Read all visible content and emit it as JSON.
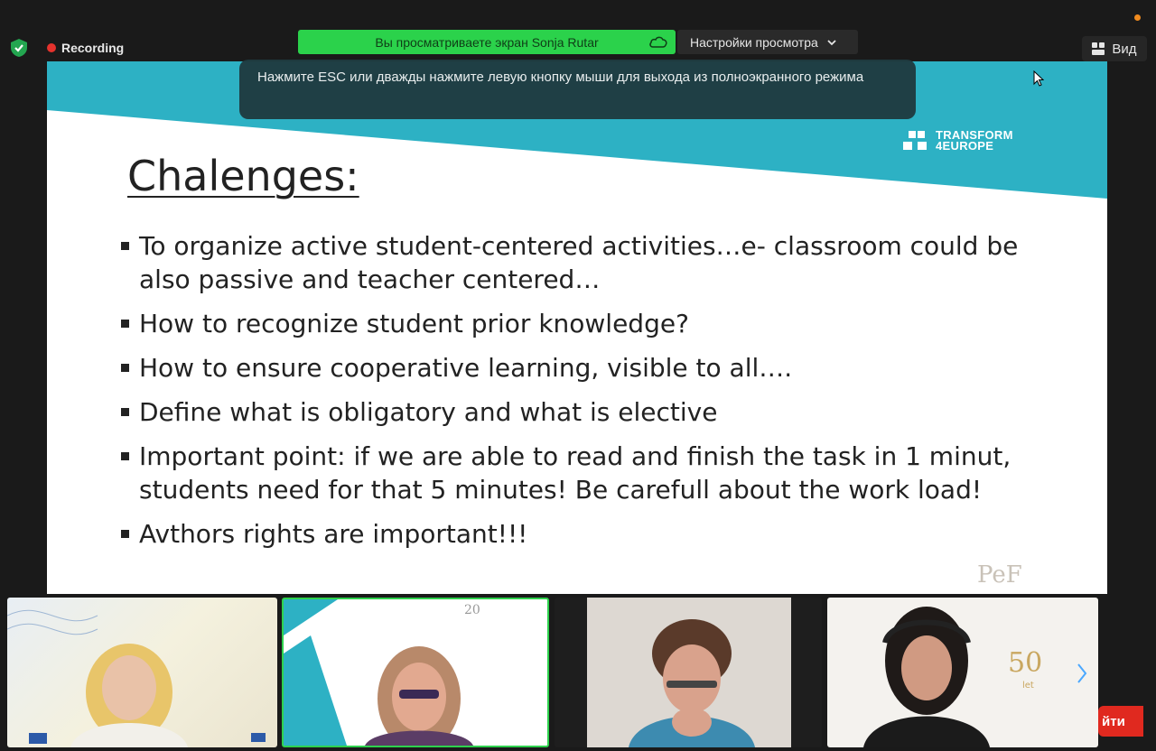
{
  "top_bar": {
    "recording_label": "Recording",
    "share_banner": "Вы просматриваете экран Sonja Rutar",
    "view_settings": "Настройки просмотра",
    "view_button": "Вид",
    "colors": {
      "banner": "#2bd24b",
      "recording": "#e5322d"
    }
  },
  "toast": {
    "message": "Нажмите ESC или дважды нажмите левую кнопку мыши для выхода из полноэкранного режима"
  },
  "slide": {
    "title": "Chalenges:",
    "logo_text_1": "TRANSFORM",
    "logo_text_2": "4EUROPE",
    "corner_logo": "PeF",
    "bullets": [
      "To organize active student-centered activities…e- classroom could be also passive and teacher centered…",
      " How to recognize student prior knowledge?",
      "How to ensure cooperative learning, visible to all….",
      "Define what is obligatory and what is elective",
      "Important point: if we are able to read and finish the task in 1 minut, students need for that 5 minutes! Be carefull about the work load!",
      "Avthors rights are important!!!"
    ],
    "colors": {
      "band": "#2db1c4"
    }
  },
  "participants": {
    "leave_label": "йти",
    "tile2_badge": "20",
    "tile4_badge_number": "50",
    "tile4_badge_word": "let"
  }
}
